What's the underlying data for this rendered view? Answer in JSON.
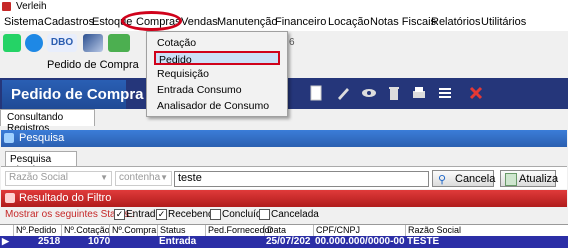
{
  "window": {
    "title": "Verleih"
  },
  "menu": [
    "Sistema",
    "Cadastros",
    "Estoque",
    "Compras",
    "Vendas",
    "Manutenção",
    "Financeiro",
    "Locação",
    "Notas Fiscais",
    "Relatórios",
    "Utilitários"
  ],
  "dropdown": [
    "Cotação",
    "Pedido",
    "Requisição",
    "Entrada Consumo",
    "Analisador de Consumo"
  ],
  "selected_dropdown": "Pedido",
  "tabs": {
    "pedido": "Pedido de Compra"
  },
  "header": {
    "title": "Pedido de Compra"
  },
  "consultando_tab": "Consultando Registros",
  "pesquisa": {
    "label": "Pesquisa",
    "tab": "Pesquisa Simples",
    "field_combo": "Razão Social",
    "op_combo": "contenha",
    "text": "teste",
    "cancel": "Cancela",
    "update": "Atualiza"
  },
  "resultado": {
    "label": "Resultado do Filtro",
    "status_label": "Mostrar os seguintes Status :",
    "status": [
      {
        "label": "Entrada",
        "checked": true
      },
      {
        "label": "Recebendo",
        "checked": true
      },
      {
        "label": "Concluída",
        "checked": false
      },
      {
        "label": "Cancelada",
        "checked": false
      }
    ]
  },
  "grid": {
    "columns": [
      "Nº.Pedido",
      "Nº.Cotação",
      "Nº.Compra",
      "Status",
      "Ped.Fornecedor",
      "Data",
      "CPF/CNPJ",
      "Razão Social"
    ],
    "row": [
      "2518",
      "1070",
      "",
      "Entrada",
      "",
      "25/07/202",
      "00.000.000/0000-00",
      "TESTE"
    ]
  },
  "colors": {
    "accent": "#d0021b",
    "header": "#25367a",
    "pesquisa": "#2b5fb0",
    "resultado": "#b01c1c",
    "row": "#2b2ea6"
  }
}
